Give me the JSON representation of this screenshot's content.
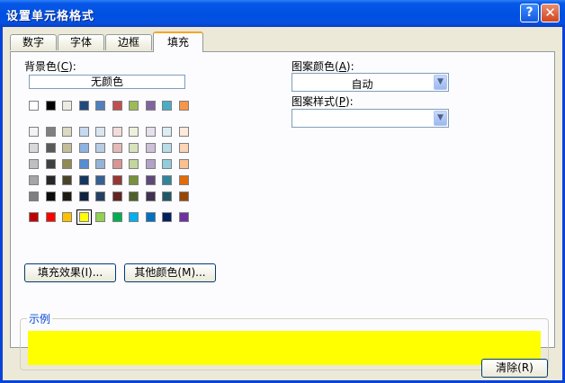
{
  "window": {
    "title": "设置单元格格式",
    "help": "?",
    "close": "✕"
  },
  "tabs": [
    {
      "label": "数字"
    },
    {
      "label": "字体"
    },
    {
      "label": "边框"
    },
    {
      "label": "填充"
    }
  ],
  "fill": {
    "bg_label": "背景色",
    "bg_key": "C",
    "no_color": "无颜色",
    "selected_color": "#ffff00",
    "row_top": [
      "#ffffff",
      "#000000",
      "#eeece1",
      "#1f497d",
      "#4f81bd",
      "#c0504d",
      "#9bbb59",
      "#8064a2",
      "#4bacc6",
      "#f79646"
    ],
    "shades": [
      [
        "#f2f2f2",
        "#7f7f7f",
        "#ddd9c3",
        "#c6d9f0",
        "#dbe5f1",
        "#f2dcdb",
        "#ebf1dd",
        "#e5e0ec",
        "#dbeef3",
        "#fdeada"
      ],
      [
        "#d8d8d8",
        "#595959",
        "#c4bd97",
        "#8db3e2",
        "#b8cce4",
        "#e5b9b7",
        "#d7e3bc",
        "#ccc1d9",
        "#b7dde8",
        "#fbd5b5"
      ],
      [
        "#bfbfbf",
        "#3f3f3f",
        "#938953",
        "#548dd4",
        "#95b3d7",
        "#d99694",
        "#c3d69b",
        "#b2a2c7",
        "#92cddc",
        "#fac08f"
      ],
      [
        "#a5a5a5",
        "#262626",
        "#494429",
        "#17365d",
        "#366092",
        "#953734",
        "#76923c",
        "#5f497a",
        "#31859b",
        "#e36c09"
      ],
      [
        "#7f7f7f",
        "#0c0c0c",
        "#1d1b10",
        "#0f243e",
        "#244061",
        "#632423",
        "#4f6128",
        "#3f3151",
        "#205867",
        "#974806"
      ]
    ],
    "standard": [
      "#c00000",
      "#ff0000",
      "#ffc000",
      "#ffff00",
      "#92d050",
      "#00b050",
      "#00b0f0",
      "#0070c0",
      "#002060",
      "#7030a0"
    ],
    "fill_effects_button": "填充效果(I)...",
    "more_colors_button": "其他颜色(M)...",
    "pattern_color_label": "图案颜色",
    "pattern_color_key": "A",
    "pattern_color_value": "自动",
    "pattern_style_label": "图案样式",
    "pattern_style_key": "P",
    "pattern_style_value": "",
    "sample_label": "示例"
  },
  "buttons": {
    "clear": "清除(R)"
  }
}
